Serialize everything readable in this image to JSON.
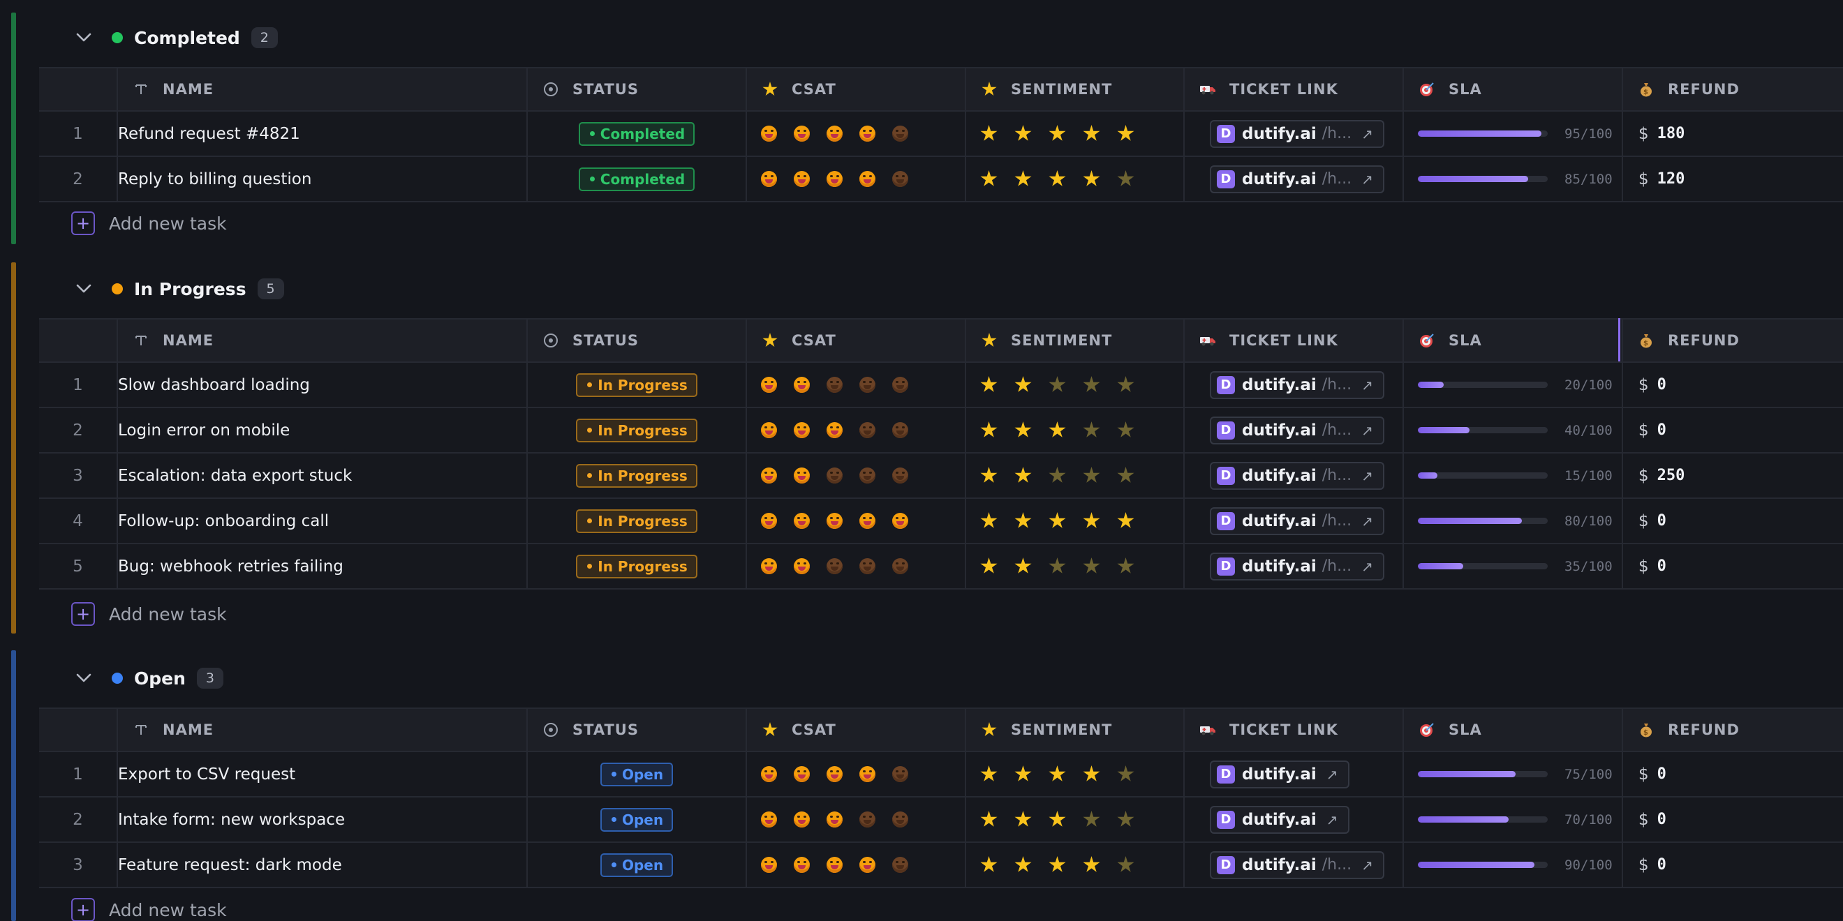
{
  "columns": {
    "name": "NAME",
    "status": "STATUS",
    "csat": "CSAT",
    "sentiment": "SENTIMENT",
    "ticket_link": "TICKET LINK",
    "sla": "SLA",
    "refund": "REFUND"
  },
  "add_task_label": "Add new task",
  "currency_symbol": "$",
  "link_domain": "dutify.ai",
  "link_path": "/h...",
  "colors": {
    "completed": "#22c55e",
    "in_progress": "#f59e0b",
    "open": "#3b82f6",
    "accent": "#8b6cf0"
  },
  "groups": [
    {
      "key": "completed",
      "title": "Completed",
      "count": "2",
      "rows": [
        {
          "num": "1",
          "name": "Refund request #4821",
          "status": "Completed",
          "csat": 4,
          "sentiment": 5,
          "has_path": true,
          "sla": 95,
          "sla_text": "95/100",
          "refund": "180"
        },
        {
          "num": "2",
          "name": "Reply to billing question",
          "status": "Completed",
          "csat": 4,
          "sentiment": 4,
          "has_path": true,
          "sla": 85,
          "sla_text": "85/100",
          "refund": "120"
        }
      ]
    },
    {
      "key": "in_progress",
      "title": "In Progress",
      "count": "5",
      "rows": [
        {
          "num": "1",
          "name": "Slow dashboard loading",
          "status": "In Progress",
          "csat": 2,
          "sentiment": 2,
          "has_path": true,
          "sla": 20,
          "sla_text": "20/100",
          "refund": "0"
        },
        {
          "num": "2",
          "name": "Login error on mobile",
          "status": "In Progress",
          "csat": 3,
          "sentiment": 3,
          "has_path": true,
          "sla": 40,
          "sla_text": "40/100",
          "refund": "0"
        },
        {
          "num": "3",
          "name": "Escalation: data export stuck",
          "status": "In Progress",
          "csat": 2,
          "sentiment": 2,
          "has_path": true,
          "sla": 15,
          "sla_text": "15/100",
          "refund": "250"
        },
        {
          "num": "4",
          "name": "Follow-up: onboarding call",
          "status": "In Progress",
          "csat": 5,
          "sentiment": 5,
          "has_path": true,
          "sla": 80,
          "sla_text": "80/100",
          "refund": "0"
        },
        {
          "num": "5",
          "name": "Bug: webhook retries failing",
          "status": "In Progress",
          "csat": 2,
          "sentiment": 2,
          "has_path": true,
          "sla": 35,
          "sla_text": "35/100",
          "refund": "0"
        }
      ]
    },
    {
      "key": "open",
      "title": "Open",
      "count": "3",
      "rows": [
        {
          "num": "1",
          "name": "Export to CSV request",
          "status": "Open",
          "csat": 4,
          "sentiment": 4,
          "has_path": false,
          "sla": 75,
          "sla_text": "75/100",
          "refund": "0"
        },
        {
          "num": "2",
          "name": "Intake form: new workspace",
          "status": "Open",
          "csat": 3,
          "sentiment": 3,
          "has_path": false,
          "sla": 70,
          "sla_text": "70/100",
          "refund": "0"
        },
        {
          "num": "3",
          "name": "Feature request: dark mode",
          "status": "Open",
          "csat": 4,
          "sentiment": 4,
          "has_path": true,
          "sla": 90,
          "sla_text": "90/100",
          "refund": "0"
        }
      ]
    }
  ]
}
